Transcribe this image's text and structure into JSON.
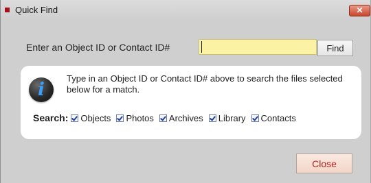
{
  "window": {
    "title": "Quick Find",
    "close_glyph": "✕",
    "accent_color": "#a6121b"
  },
  "form": {
    "prompt_label": "Enter an Object ID or Contact ID#",
    "input_value": "",
    "find_label": "Find"
  },
  "info": {
    "icon_glyph": "i",
    "text": "Type in an Object ID or Contact ID# above to search the files selected below for a match."
  },
  "search": {
    "label": "Search:",
    "options": [
      {
        "label": "Objects",
        "checked": true
      },
      {
        "label": "Photos",
        "checked": true
      },
      {
        "label": "Archives",
        "checked": true
      },
      {
        "label": "Library",
        "checked": true
      },
      {
        "label": "Contacts",
        "checked": true
      }
    ]
  },
  "footer": {
    "close_label": "Close"
  }
}
